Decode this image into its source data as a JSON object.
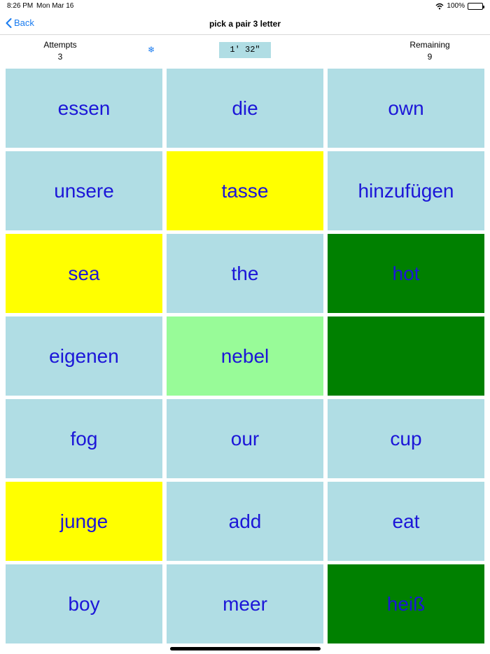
{
  "status_bar": {
    "time": "8:26 PM",
    "date": "Mon Mar 16",
    "battery": "100%",
    "battery_level": 1.0
  },
  "nav": {
    "back_label": "Back",
    "title": "pick a pair 3 letter"
  },
  "stats": {
    "attempts_label": "Attempts",
    "attempts_value": "3",
    "timer": "1' 32\"",
    "remaining_label": "Remaining",
    "remaining_value": "9"
  },
  "icons": {
    "back": "chevron-left-icon",
    "snow": "snowflake-icon",
    "wifi": "wifi-icon",
    "battery": "battery-icon"
  },
  "colors": {
    "tile_default": "#b0dde4",
    "tile_selected": "#ffff00",
    "tile_matched": "#008000",
    "tile_highlight": "#98fb98",
    "word_text": "#1c16d8",
    "accent": "#1a7cf0"
  },
  "tiles": [
    {
      "word": "essen",
      "state": "default"
    },
    {
      "word": "die",
      "state": "default"
    },
    {
      "word": "own",
      "state": "default"
    },
    {
      "word": "unsere",
      "state": "default"
    },
    {
      "word": "tasse",
      "state": "selected"
    },
    {
      "word": "hinzufügen",
      "state": "default"
    },
    {
      "word": "sea",
      "state": "selected"
    },
    {
      "word": "the",
      "state": "default"
    },
    {
      "word": "hot",
      "state": "matched"
    },
    {
      "word": "eigenen",
      "state": "default"
    },
    {
      "word": "nebel",
      "state": "highlight"
    },
    {
      "word": "",
      "state": "matched"
    },
    {
      "word": "fog",
      "state": "default"
    },
    {
      "word": "our",
      "state": "default"
    },
    {
      "word": "cup",
      "state": "default"
    },
    {
      "word": "junge",
      "state": "selected"
    },
    {
      "word": "add",
      "state": "default"
    },
    {
      "word": "eat",
      "state": "default"
    },
    {
      "word": "boy",
      "state": "default"
    },
    {
      "word": "meer",
      "state": "default"
    },
    {
      "word": "heiß",
      "state": "matched"
    }
  ]
}
